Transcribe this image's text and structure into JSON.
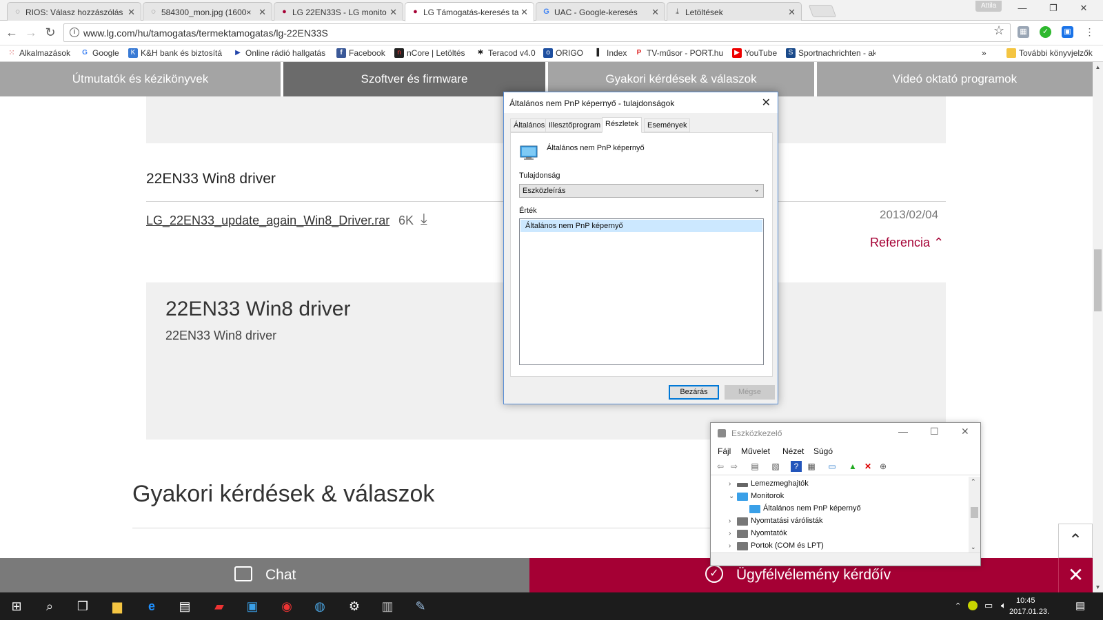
{
  "browser": {
    "tabs": [
      {
        "label": "RIOS: Válasz hozzászólás"
      },
      {
        "label": "584300_mon.jpg (1600×"
      },
      {
        "label": "LG 22EN33S - LG monito"
      },
      {
        "label": "LG Támogatás-keresés ta"
      },
      {
        "label": "UAC - Google-keresés"
      },
      {
        "label": "Letöltések"
      }
    ],
    "user": "Attila",
    "url": "www.lg.com/hu/tamogatas/termektamogatas/lg-22EN33S",
    "bookmarks": [
      "Alkalmazások",
      "Google",
      "K&H bank és biztosítá",
      "Online rádió hallgatás",
      "Facebook",
      "nCore | Letöltés",
      "Teracod v4.0",
      "ORIGO",
      "Index",
      "TV-műsor - PORT.hu",
      "YouTube",
      "Sportnachrichten - ak"
    ],
    "more_bookmarks": "»",
    "other_bookmarks": "További könyvjelzők"
  },
  "lg": {
    "nav": [
      "Útmutatók és kézikönyvek",
      "Szoftver és firmware",
      "Gyakori kérdések & válaszok",
      "Videó oktató programok"
    ],
    "driver_title": "22EN33 Win8 driver",
    "driver_file": "LG_22EN33_update_again_Win8_Driver.rar",
    "driver_size": "6K",
    "driver_date": "2013/02/04",
    "reference": "Referencia",
    "detail_title": "22EN33 Win8 driver",
    "detail_sub": "22EN33 Win8 driver",
    "faq_title": "Gyakori kérdések & válaszok",
    "chat": "Chat",
    "survey": "Ügyfélvélemény kérdőív"
  },
  "dialog": {
    "title": "Általános nem PnP képernyő - tulajdonságok",
    "tabs": [
      "Általános",
      "Illesztőprogram",
      "Részletek",
      "Események"
    ],
    "device_name": "Általános nem PnP képernyő",
    "property_label": "Tulajdonság",
    "property_value": "Eszközleírás",
    "value_label": "Érték",
    "value_item": "Általános nem PnP képernyő",
    "ok": "Bezárás",
    "cancel": "Mégse"
  },
  "devmgr": {
    "title": "Eszközkezelő",
    "menu": [
      "Fájl",
      "Művelet",
      "Nézet",
      "Súgó"
    ],
    "tree": [
      {
        "label": "Lemezmeghajtók",
        "expander": "›"
      },
      {
        "label": "Monitorok",
        "expander": "⌄"
      },
      {
        "label": "Általános nem PnP képernyő",
        "expander": ""
      },
      {
        "label": "Nyomtatási várólisták",
        "expander": "›"
      },
      {
        "label": "Nyomtatók",
        "expander": "›"
      },
      {
        "label": "Portok (COM és LPT)",
        "expander": "›"
      }
    ]
  },
  "taskbar": {
    "time": "10:45",
    "date": "2017.01.23."
  },
  "colors": {
    "lg_red": "#a50034",
    "nav_gray": "#a4a4a4",
    "nav_active": "#6b6b6b"
  }
}
